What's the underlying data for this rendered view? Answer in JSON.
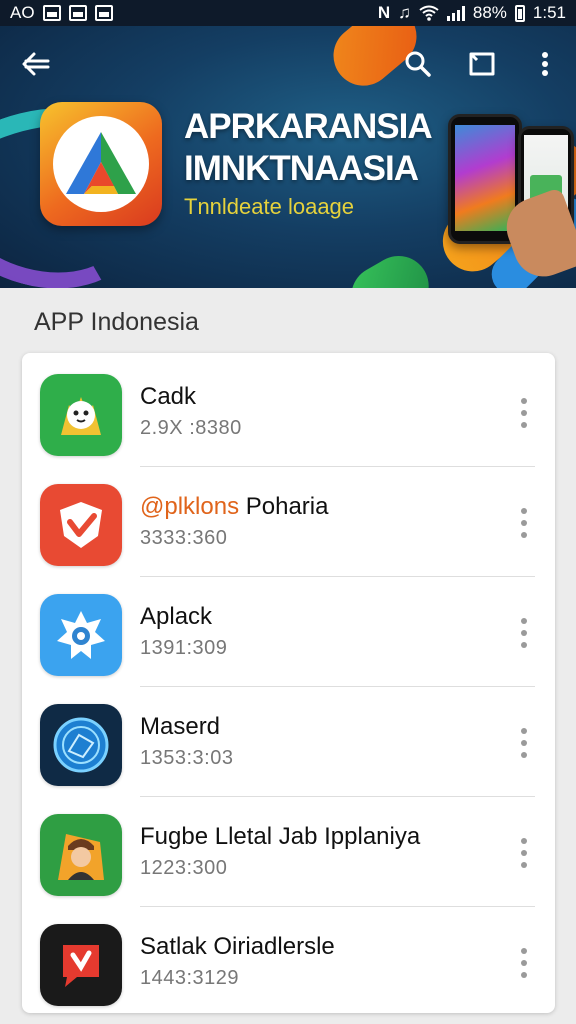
{
  "status_bar": {
    "left_text": "AO",
    "battery": "88%",
    "time": "1:51"
  },
  "banner": {
    "title_line1": "APRKARANSIA",
    "title_line2": "IMNKTNAASIA",
    "tagline": "Tnnldeate loaage",
    "colors": {
      "bg": "#143e63",
      "accent_orange": "#ef6e15",
      "tagline": "#e6d23c"
    }
  },
  "toolbar": {
    "back_icon": "arrow-left-icon",
    "search_icon": "search-icon",
    "cast_icon": "cast-icon",
    "more_icon": "more-vert-icon"
  },
  "section": {
    "title": "APP Indonesia"
  },
  "apps": [
    {
      "name": "Cadk",
      "meta": "2.9X :8380",
      "icon": "mascot-icon",
      "icon_bg": "#2fae4a"
    },
    {
      "name_accent": "@plklons",
      "name": " Poharia",
      "meta": "3333:360",
      "icon": "shield-check-icon",
      "icon_bg": "#e84a33"
    },
    {
      "name": "Aplack",
      "meta": "1391:309",
      "icon": "camera-shutter-icon",
      "icon_bg": "#3ba3ef"
    },
    {
      "name": "Maserd",
      "meta": "1353:3:03",
      "icon": "globe-icon",
      "icon_bg": "#0f2a45"
    },
    {
      "name": "Fugbe Lletal Jab Ipplaniya",
      "meta": "1223:300",
      "icon": "character-icon",
      "icon_bg": "#2f9e43"
    },
    {
      "name": "Satlak Oiriadlersle",
      "meta": "1443:3129",
      "icon": "chat-bubble-icon",
      "icon_bg": "#1a1a1a"
    }
  ]
}
